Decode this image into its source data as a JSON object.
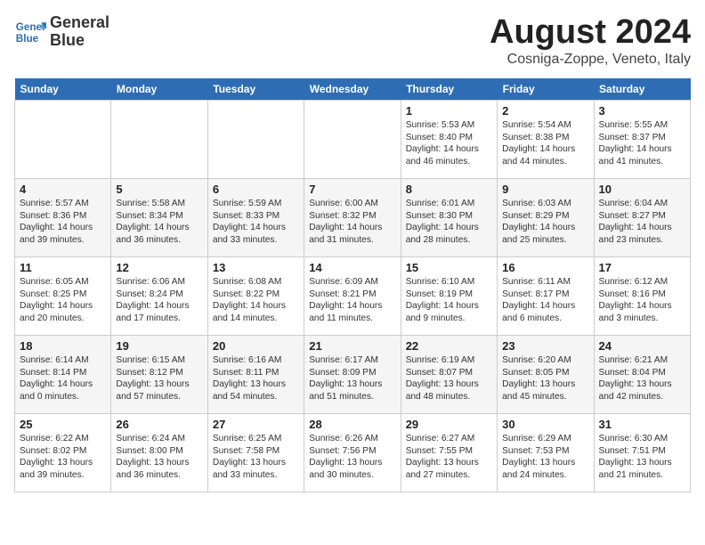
{
  "header": {
    "logo_line1": "General",
    "logo_line2": "Blue",
    "month_year": "August 2024",
    "location": "Cosniga-Zoppe, Veneto, Italy"
  },
  "days_of_week": [
    "Sunday",
    "Monday",
    "Tuesday",
    "Wednesday",
    "Thursday",
    "Friday",
    "Saturday"
  ],
  "weeks": [
    [
      {
        "day": "",
        "info": ""
      },
      {
        "day": "",
        "info": ""
      },
      {
        "day": "",
        "info": ""
      },
      {
        "day": "",
        "info": ""
      },
      {
        "day": "1",
        "info": "Sunrise: 5:53 AM\nSunset: 8:40 PM\nDaylight: 14 hours\nand 46 minutes."
      },
      {
        "day": "2",
        "info": "Sunrise: 5:54 AM\nSunset: 8:38 PM\nDaylight: 14 hours\nand 44 minutes."
      },
      {
        "day": "3",
        "info": "Sunrise: 5:55 AM\nSunset: 8:37 PM\nDaylight: 14 hours\nand 41 minutes."
      }
    ],
    [
      {
        "day": "4",
        "info": "Sunrise: 5:57 AM\nSunset: 8:36 PM\nDaylight: 14 hours\nand 39 minutes."
      },
      {
        "day": "5",
        "info": "Sunrise: 5:58 AM\nSunset: 8:34 PM\nDaylight: 14 hours\nand 36 minutes."
      },
      {
        "day": "6",
        "info": "Sunrise: 5:59 AM\nSunset: 8:33 PM\nDaylight: 14 hours\nand 33 minutes."
      },
      {
        "day": "7",
        "info": "Sunrise: 6:00 AM\nSunset: 8:32 PM\nDaylight: 14 hours\nand 31 minutes."
      },
      {
        "day": "8",
        "info": "Sunrise: 6:01 AM\nSunset: 8:30 PM\nDaylight: 14 hours\nand 28 minutes."
      },
      {
        "day": "9",
        "info": "Sunrise: 6:03 AM\nSunset: 8:29 PM\nDaylight: 14 hours\nand 25 minutes."
      },
      {
        "day": "10",
        "info": "Sunrise: 6:04 AM\nSunset: 8:27 PM\nDaylight: 14 hours\nand 23 minutes."
      }
    ],
    [
      {
        "day": "11",
        "info": "Sunrise: 6:05 AM\nSunset: 8:25 PM\nDaylight: 14 hours\nand 20 minutes."
      },
      {
        "day": "12",
        "info": "Sunrise: 6:06 AM\nSunset: 8:24 PM\nDaylight: 14 hours\nand 17 minutes."
      },
      {
        "day": "13",
        "info": "Sunrise: 6:08 AM\nSunset: 8:22 PM\nDaylight: 14 hours\nand 14 minutes."
      },
      {
        "day": "14",
        "info": "Sunrise: 6:09 AM\nSunset: 8:21 PM\nDaylight: 14 hours\nand 11 minutes."
      },
      {
        "day": "15",
        "info": "Sunrise: 6:10 AM\nSunset: 8:19 PM\nDaylight: 14 hours\nand 9 minutes."
      },
      {
        "day": "16",
        "info": "Sunrise: 6:11 AM\nSunset: 8:17 PM\nDaylight: 14 hours\nand 6 minutes."
      },
      {
        "day": "17",
        "info": "Sunrise: 6:12 AM\nSunset: 8:16 PM\nDaylight: 14 hours\nand 3 minutes."
      }
    ],
    [
      {
        "day": "18",
        "info": "Sunrise: 6:14 AM\nSunset: 8:14 PM\nDaylight: 14 hours\nand 0 minutes."
      },
      {
        "day": "19",
        "info": "Sunrise: 6:15 AM\nSunset: 8:12 PM\nDaylight: 13 hours\nand 57 minutes."
      },
      {
        "day": "20",
        "info": "Sunrise: 6:16 AM\nSunset: 8:11 PM\nDaylight: 13 hours\nand 54 minutes."
      },
      {
        "day": "21",
        "info": "Sunrise: 6:17 AM\nSunset: 8:09 PM\nDaylight: 13 hours\nand 51 minutes."
      },
      {
        "day": "22",
        "info": "Sunrise: 6:19 AM\nSunset: 8:07 PM\nDaylight: 13 hours\nand 48 minutes."
      },
      {
        "day": "23",
        "info": "Sunrise: 6:20 AM\nSunset: 8:05 PM\nDaylight: 13 hours\nand 45 minutes."
      },
      {
        "day": "24",
        "info": "Sunrise: 6:21 AM\nSunset: 8:04 PM\nDaylight: 13 hours\nand 42 minutes."
      }
    ],
    [
      {
        "day": "25",
        "info": "Sunrise: 6:22 AM\nSunset: 8:02 PM\nDaylight: 13 hours\nand 39 minutes."
      },
      {
        "day": "26",
        "info": "Sunrise: 6:24 AM\nSunset: 8:00 PM\nDaylight: 13 hours\nand 36 minutes."
      },
      {
        "day": "27",
        "info": "Sunrise: 6:25 AM\nSunset: 7:58 PM\nDaylight: 13 hours\nand 33 minutes."
      },
      {
        "day": "28",
        "info": "Sunrise: 6:26 AM\nSunset: 7:56 PM\nDaylight: 13 hours\nand 30 minutes."
      },
      {
        "day": "29",
        "info": "Sunrise: 6:27 AM\nSunset: 7:55 PM\nDaylight: 13 hours\nand 27 minutes."
      },
      {
        "day": "30",
        "info": "Sunrise: 6:29 AM\nSunset: 7:53 PM\nDaylight: 13 hours\nand 24 minutes."
      },
      {
        "day": "31",
        "info": "Sunrise: 6:30 AM\nSunset: 7:51 PM\nDaylight: 13 hours\nand 21 minutes."
      }
    ]
  ]
}
